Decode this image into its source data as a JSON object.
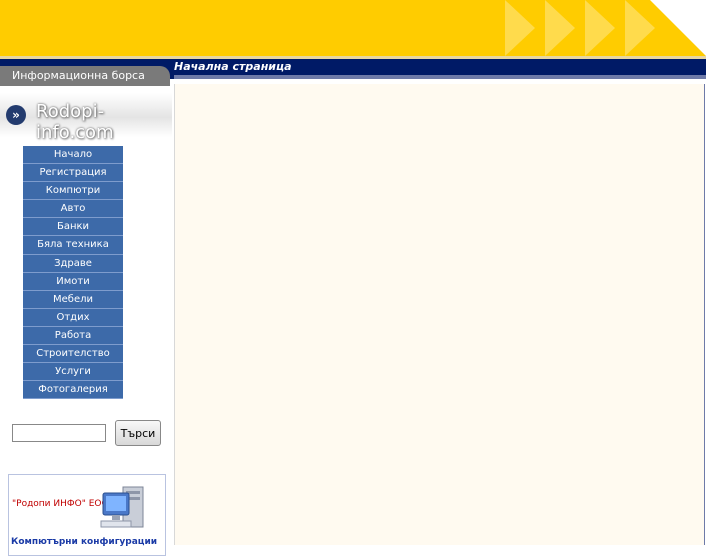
{
  "header": {
    "section_tab": "Информационна борса",
    "page_title": "Начална страница"
  },
  "logo": {
    "text": "Rodopi-info.com",
    "icon": "double-chevron-right-icon"
  },
  "menu": {
    "items": [
      {
        "label": "Начало"
      },
      {
        "label": "Регистрация"
      },
      {
        "label": "Компютри"
      },
      {
        "label": "Авто"
      },
      {
        "label": "Банки"
      },
      {
        "label": "Бяла техника"
      },
      {
        "label": "Здраве"
      },
      {
        "label": "Имоти"
      },
      {
        "label": "Мебели"
      },
      {
        "label": "Отдих"
      },
      {
        "label": "Работа"
      },
      {
        "label": "Строителство"
      },
      {
        "label": "Услуги"
      },
      {
        "label": "Фотогалерия"
      }
    ]
  },
  "search": {
    "value": "",
    "button_label": "Търси"
  },
  "ad": {
    "company": "\"Родопи ИНФО\" ЕООД",
    "caption": "Компютърни конфигурации",
    "icon": "computer-icon"
  },
  "colors": {
    "banner": "#ffcc00",
    "navbar": "#001a66",
    "menu": "#3d6aa9",
    "content_bg": "#fffaf0"
  }
}
